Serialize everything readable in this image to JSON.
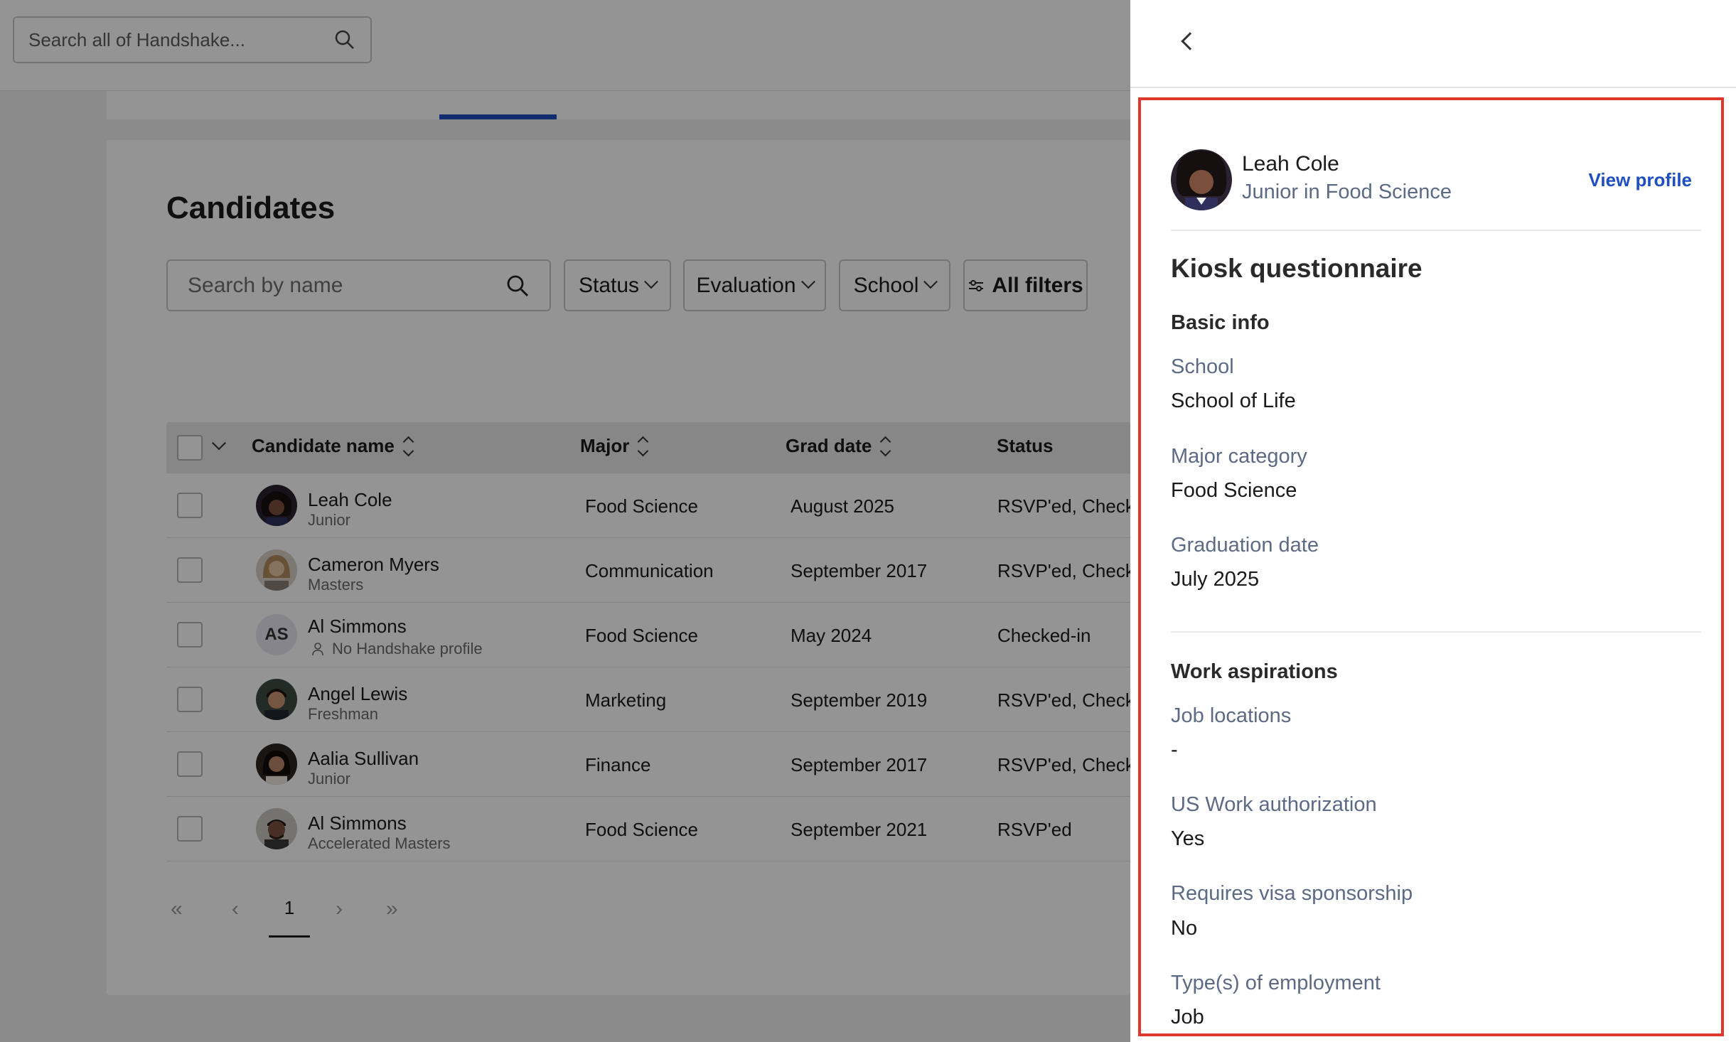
{
  "topbar": {
    "search_placeholder": "Search all of Handshake..."
  },
  "candidates": {
    "title": "Candidates",
    "search_placeholder": "Search by name",
    "filters": {
      "status": "Status",
      "evaluation": "Evaluation",
      "school": "School",
      "all_filters": "All filters"
    },
    "columns": {
      "name": "Candidate name",
      "major": "Major",
      "grad_date": "Grad date",
      "status": "Status"
    },
    "rows": [
      {
        "name": "Leah Cole",
        "sub": "Junior",
        "major": "Food Science",
        "grad": "August 2025",
        "status": "RSVP'ed, Check"
      },
      {
        "name": "Cameron Myers",
        "sub": "Masters",
        "major": "Communication",
        "grad": "September 2017",
        "status": "RSVP'ed, Check"
      },
      {
        "name": "Al Simmons",
        "initials": "AS",
        "sub": "No Handshake profile",
        "major": "Food Science",
        "grad": "May 2024",
        "status": "Checked-in"
      },
      {
        "name": "Angel Lewis",
        "sub": "Freshman",
        "major": "Marketing",
        "grad": "September 2019",
        "status": "RSVP'ed, Check"
      },
      {
        "name": "Aalia Sullivan",
        "sub": "Junior",
        "major": "Finance",
        "grad": "September 2017",
        "status": "RSVP'ed, Check"
      },
      {
        "name": "Al Simmons",
        "sub": "Accelerated Masters",
        "major": "Food Science",
        "grad": "September 2021",
        "status": "RSVP'ed"
      }
    ],
    "pagination": {
      "current": "1"
    }
  },
  "drawer": {
    "profile": {
      "name": "Leah Cole",
      "subtitle": "Junior in Food Science",
      "view_profile": "View profile"
    },
    "questionnaire_title": "Kiosk questionnaire",
    "basic_info": {
      "title": "Basic info",
      "school_label": "School",
      "school_value": "School of Life",
      "major_label": "Major category",
      "major_value": "Food Science",
      "grad_label": "Graduation date",
      "grad_value": "July 2025"
    },
    "work": {
      "title": "Work aspirations",
      "locations_label": "Job locations",
      "locations_value": "-",
      "auth_label": "US Work authorization",
      "auth_value": "Yes",
      "visa_label": "Requires visa sponsorship",
      "visa_value": "No",
      "employment_label": "Type(s) of employment",
      "employment_value": "Job"
    }
  },
  "colors": {
    "accent": "#1f4fbf",
    "highlight": "#e0392b",
    "label": "#5d6a85"
  }
}
